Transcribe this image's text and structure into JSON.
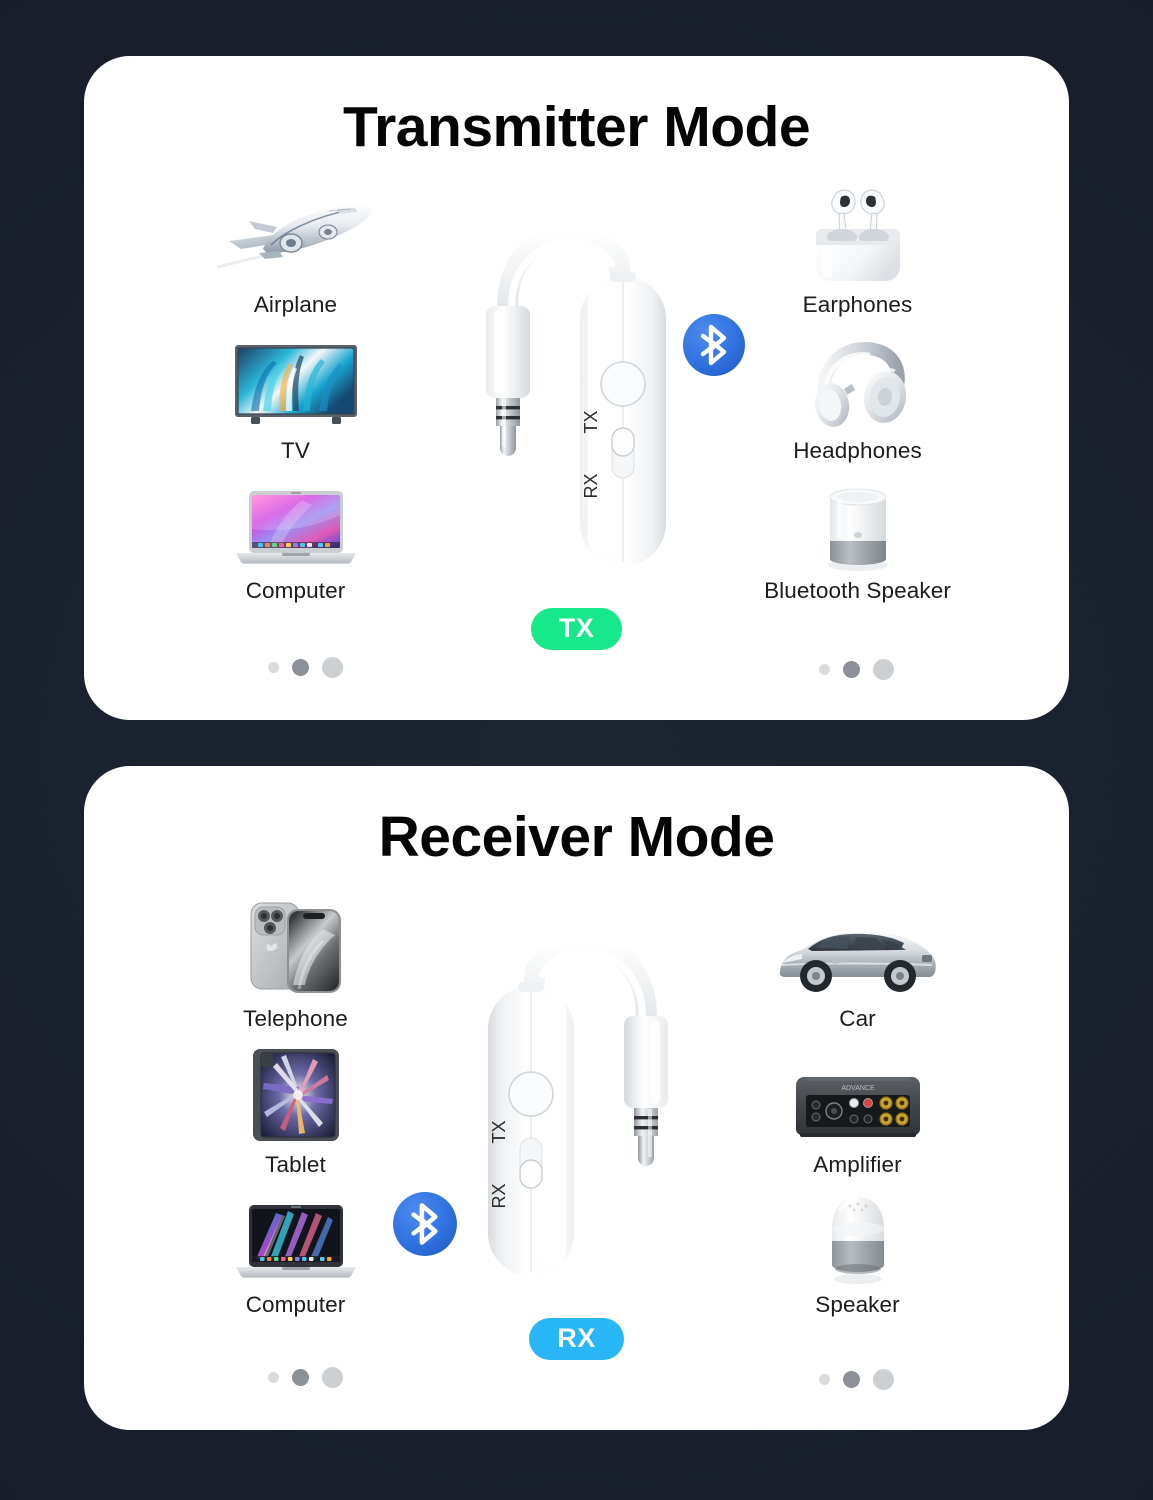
{
  "theme": {
    "background": "#1b2230",
    "card_background": "#ffffff",
    "title_color": "#050505",
    "label_color": "#1c1c1c",
    "tx_badge_color": "#17e98a",
    "rx_badge_color": "#29b6f6",
    "bluetooth_blue": "#2f72e0",
    "dot_active": "#8b9197",
    "dot_inactive": "#d2d6d9"
  },
  "cards": [
    {
      "id": "transmitter",
      "title": "Transmitter Mode",
      "badge": "TX",
      "badge_color": "#17e98a",
      "switch_position": "tx",
      "device_orientation": "jack-left",
      "bluetooth_side": "right",
      "sources": [
        {
          "label": "Airplane",
          "icon": "airplane-icon"
        },
        {
          "label": "TV",
          "icon": "tv-icon"
        },
        {
          "label": "Computer",
          "icon": "laptop-icon"
        }
      ],
      "targets": [
        {
          "label": "Earphones",
          "icon": "earbuds-case-icon"
        },
        {
          "label": "Headphones",
          "icon": "over-ear-headphones-icon"
        },
        {
          "label": "Bluetooth Speaker",
          "icon": "cylinder-speaker-icon"
        }
      ],
      "device_labels": {
        "tx": "TX",
        "rx": "RX"
      }
    },
    {
      "id": "receiver",
      "title": "Receiver Mode",
      "badge": "RX",
      "badge_color": "#29b6f6",
      "switch_position": "rx",
      "device_orientation": "jack-right",
      "bluetooth_side": "left",
      "sources": [
        {
          "label": "Telephone",
          "icon": "smartphone-icon"
        },
        {
          "label": "Tablet",
          "icon": "tablet-icon"
        },
        {
          "label": "Computer",
          "icon": "laptop-icon"
        }
      ],
      "targets": [
        {
          "label": "Car",
          "icon": "car-icon"
        },
        {
          "label": "Amplifier",
          "icon": "amplifier-icon"
        },
        {
          "label": "Speaker",
          "icon": "smart-speaker-icon"
        }
      ],
      "device_labels": {
        "tx": "TX",
        "rx": "RX"
      }
    }
  ],
  "carousel": {
    "dot_count": 3,
    "active_index": 1
  }
}
